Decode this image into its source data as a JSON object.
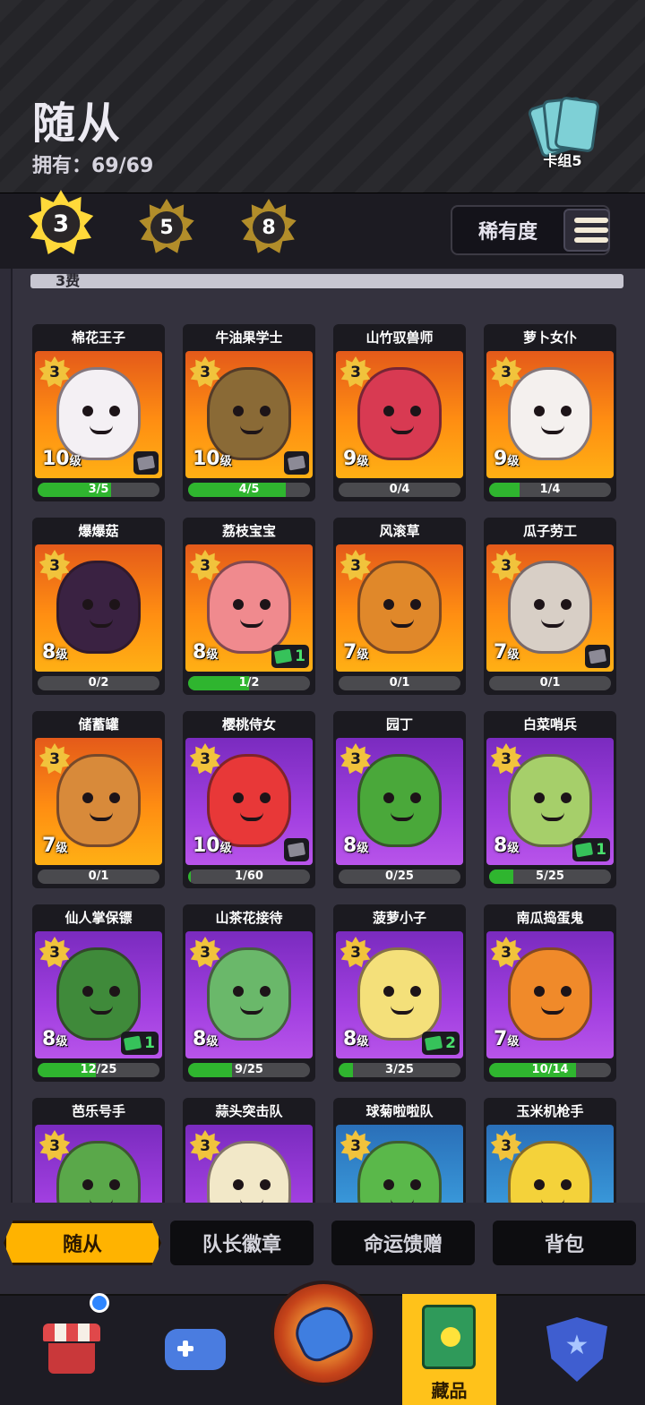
{
  "header": {
    "title": "随从",
    "owned": "拥有：69/69",
    "deck_label": "卡组5"
  },
  "filters": {
    "costs": [
      "3",
      "5",
      "8"
    ],
    "active_cost": "3",
    "rarity_label": "稀有度"
  },
  "section": {
    "cost_label": "3费"
  },
  "cards": [
    {
      "name": "棉花王子",
      "cost": "3",
      "level": "10",
      "progress": "3/5",
      "fill": 0.6,
      "bg": "orange",
      "color": "#f4f0f4",
      "tag": "card"
    },
    {
      "name": "牛油果学士",
      "cost": "3",
      "level": "10",
      "progress": "4/5",
      "fill": 0.8,
      "bg": "orange",
      "color": "#8a6a36",
      "tag": "card"
    },
    {
      "name": "山竹驭兽师",
      "cost": "3",
      "level": "9",
      "progress": "0/4",
      "fill": 0,
      "bg": "orange",
      "color": "#d83a52",
      "tag": ""
    },
    {
      "name": "萝卜女仆",
      "cost": "3",
      "level": "9",
      "progress": "1/4",
      "fill": 0.25,
      "bg": "orange",
      "color": "#f4f0ee",
      "tag": ""
    },
    {
      "name": "爆爆菇",
      "cost": "3",
      "level": "8",
      "progress": "0/2",
      "fill": 0,
      "bg": "orange",
      "color": "#3a2242",
      "tag": ""
    },
    {
      "name": "荔枝宝宝",
      "cost": "3",
      "level": "8",
      "progress": "1/2",
      "fill": 0.5,
      "bg": "orange",
      "color": "#f08a8e",
      "tag": "green",
      "tag_count": "1"
    },
    {
      "name": "风滚草",
      "cost": "3",
      "level": "7",
      "progress": "0/1",
      "fill": 0,
      "bg": "orange",
      "color": "#e0882a",
      "tag": ""
    },
    {
      "name": "瓜子劳工",
      "cost": "3",
      "level": "7",
      "progress": "0/1",
      "fill": 0,
      "bg": "orange",
      "color": "#d8cfc6",
      "tag": "card"
    },
    {
      "name": "储蓄罐",
      "cost": "3",
      "level": "7",
      "progress": "0/1",
      "fill": 0,
      "bg": "orange",
      "color": "#d88a3a",
      "tag": ""
    },
    {
      "name": "樱桃侍女",
      "cost": "3",
      "level": "10",
      "progress": "1/60",
      "fill": 0.02,
      "bg": "purple",
      "color": "#e83838",
      "tag": "card"
    },
    {
      "name": "园丁",
      "cost": "3",
      "level": "8",
      "progress": "0/25",
      "fill": 0,
      "bg": "purple",
      "color": "#4aa83a",
      "tag": ""
    },
    {
      "name": "白菜哨兵",
      "cost": "3",
      "level": "8",
      "progress": "5/25",
      "fill": 0.2,
      "bg": "purple",
      "color": "#a6cf6a",
      "tag": "green",
      "tag_count": "1"
    },
    {
      "name": "仙人掌保镖",
      "cost": "3",
      "level": "8",
      "progress": "12/25",
      "fill": 0.48,
      "bg": "purple",
      "color": "#3f8a3a",
      "tag": "green",
      "tag_count": "1"
    },
    {
      "name": "山茶花接待",
      "cost": "3",
      "level": "8",
      "progress": "9/25",
      "fill": 0.36,
      "bg": "purple",
      "color": "#6ab86a",
      "tag": ""
    },
    {
      "name": "菠萝小子",
      "cost": "3",
      "level": "8",
      "progress": "3/25",
      "fill": 0.12,
      "bg": "purple",
      "color": "#f4e07a",
      "tag": "green",
      "tag_count": "2"
    },
    {
      "name": "南瓜捣蛋鬼",
      "cost": "3",
      "level": "7",
      "progress": "10/14",
      "fill": 0.71,
      "bg": "purple",
      "color": "#f08a2a",
      "tag": ""
    },
    {
      "name": "芭乐号手",
      "cost": "3",
      "level": "",
      "progress": "",
      "fill": 0,
      "bg": "purple",
      "color": "#5aa84a",
      "tag": ""
    },
    {
      "name": "蒜头突击队",
      "cost": "3",
      "level": "",
      "progress": "",
      "fill": 0,
      "bg": "purple",
      "color": "#f2e8c8",
      "tag": ""
    },
    {
      "name": "球菊啦啦队",
      "cost": "3",
      "level": "",
      "progress": "",
      "fill": 0,
      "bg": "blue",
      "color": "#5ab84a",
      "tag": ""
    },
    {
      "name": "玉米机枪手",
      "cost": "3",
      "level": "",
      "progress": "",
      "fill": 0,
      "bg": "blue",
      "color": "#f4d23a",
      "tag": ""
    }
  ],
  "level_suffix": "级",
  "subtabs": [
    "随从",
    "队长徽章",
    "命运馈赠",
    "背包"
  ],
  "nav": {
    "collection_label": "藏品"
  }
}
